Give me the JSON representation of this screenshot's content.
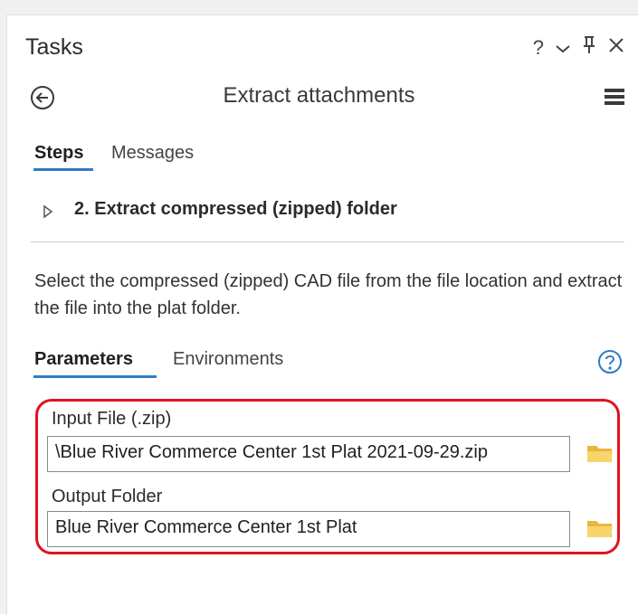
{
  "pane": {
    "title": "Tasks",
    "controls": {
      "help": "?",
      "dropdown": "⌄",
      "pin": "ᵖ",
      "close": "✕"
    }
  },
  "header": {
    "tool_title": "Extract attachments"
  },
  "tabs": [
    {
      "label": "Steps",
      "active": true
    },
    {
      "label": "Messages",
      "active": false
    }
  ],
  "step": {
    "number_title": "2.  Extract compressed (zipped) folder"
  },
  "description": "Select the compressed (zipped) CAD file from the file location and extract the file into the plat folder.",
  "param_tabs": [
    {
      "label": "Parameters",
      "active": true
    },
    {
      "label": "Environments",
      "active": false
    }
  ],
  "params": {
    "input_file": {
      "label": "Input File (.zip)",
      "value": "\\Blue River Commerce Center 1st Plat 2021-09-29.zip"
    },
    "output_folder": {
      "label": "Output Folder",
      "value": "Blue River Commerce Center 1st Plat"
    }
  },
  "colors": {
    "accent": "#2e7bc4",
    "highlight": "#e0141e",
    "folder": "#f2c94c"
  }
}
